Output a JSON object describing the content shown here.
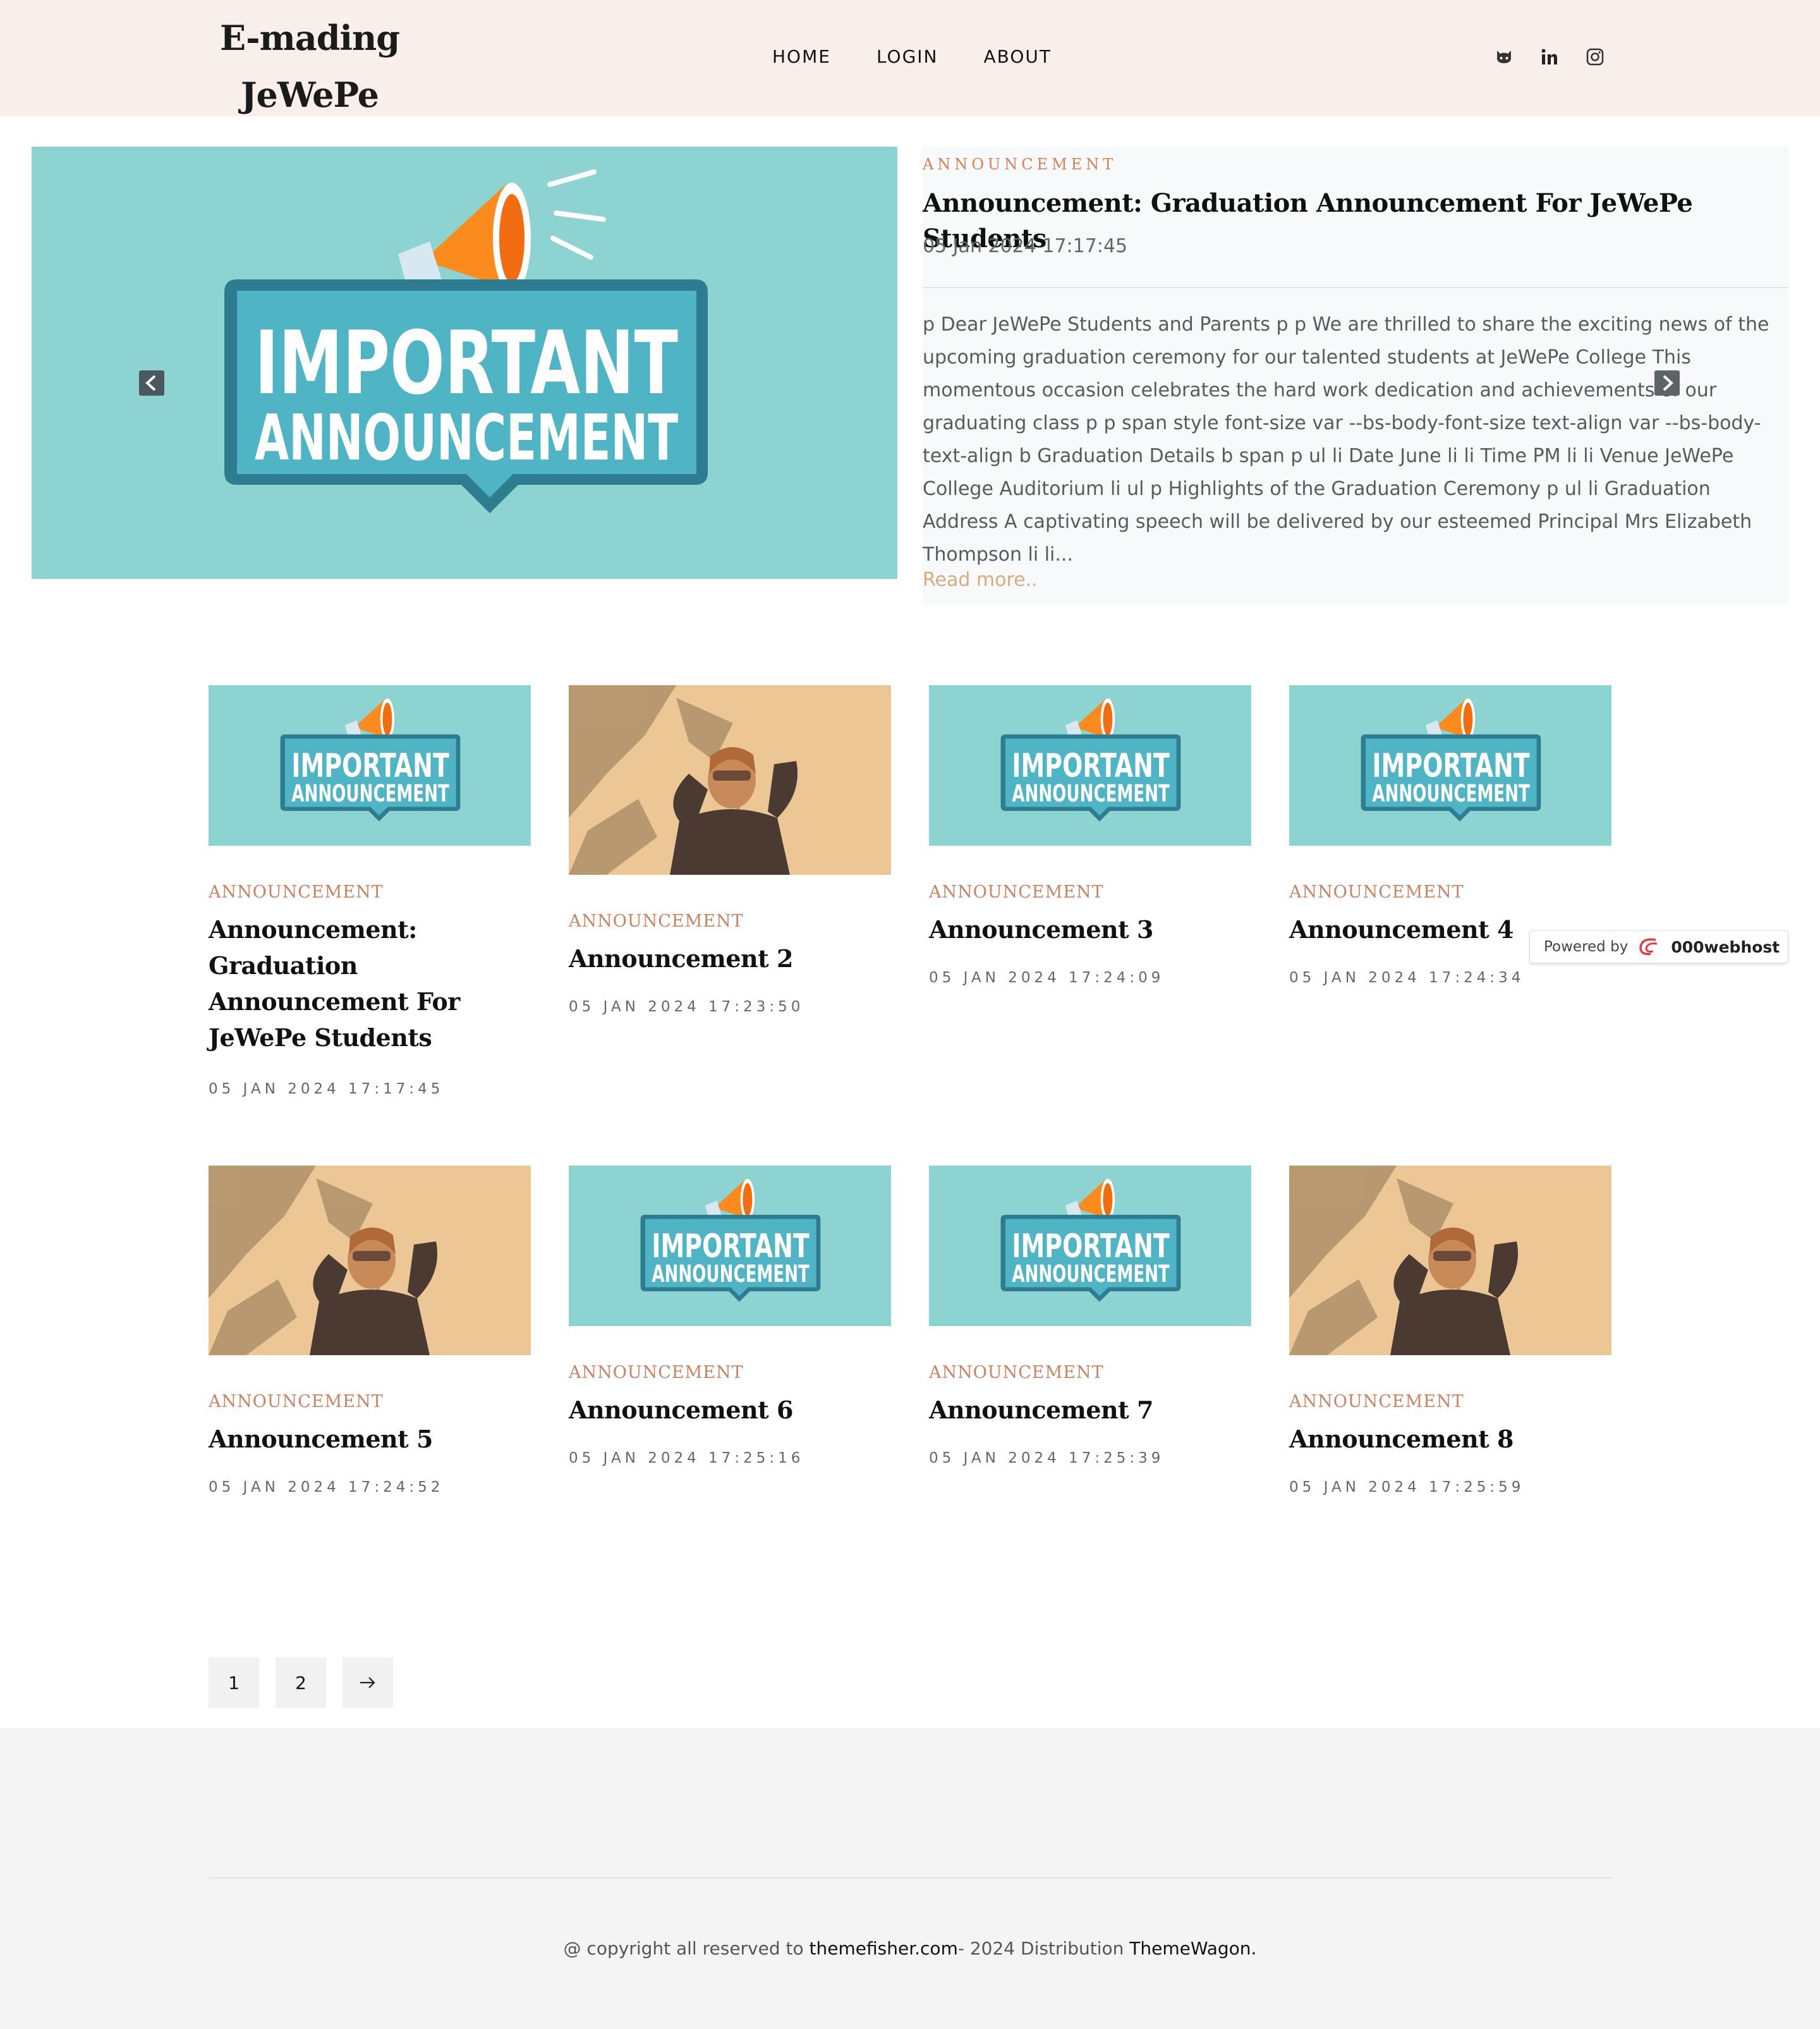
{
  "header": {
    "logo_line1": "E-mading",
    "logo_line2": "JeWePe",
    "nav": [
      {
        "label": "HOME"
      },
      {
        "label": "LOGIN"
      },
      {
        "label": "ABOUT"
      }
    ],
    "social_icons": [
      "github-icon",
      "linkedin-icon",
      "instagram-icon"
    ]
  },
  "featured": {
    "image_text_line1": "IMPORTANT",
    "image_text_line2": "ANNOUNCEMENT",
    "category": "ANNOUNCEMENT",
    "title": "Announcement: Graduation Announcement For JeWePe Students",
    "date": "05 Jan 2024 17:17:45",
    "excerpt": "p Dear JeWePe Students and Parents p p We are thrilled to share the exciting news of the upcoming graduation ceremony for our talented students at JeWePe College This momentous occasion celebrates the hard work dedication and achievements of our graduating class p p span style font-size var --bs-body-font-size text-align var --bs-body-text-align b Graduation Details b span p ul li Date June li li Time PM li li Venue JeWePe College Auditorium li ul p Highlights of the Graduation Ceremony p ul li Graduation Address A captivating speech will be delivered by our esteemed Principal Mrs Elizabeth Thompson li li...",
    "read_more": "Read more.."
  },
  "cards": [
    {
      "category": "ANNOUNCEMENT",
      "title": "Announcement: Graduation Announcement For JeWePe Students",
      "date": "05 JAN 2024 17:17:45",
      "image": "announcement"
    },
    {
      "category": "ANNOUNCEMENT",
      "title": "Announcement 2",
      "date": "05 JAN 2024 17:23:50",
      "image": "photo"
    },
    {
      "category": "ANNOUNCEMENT",
      "title": "Announcement 3",
      "date": "05 JAN 2024 17:24:09",
      "image": "announcement"
    },
    {
      "category": "ANNOUNCEMENT",
      "title": "Announcement 4",
      "date": "05 JAN 2024 17:24:34",
      "image": "announcement"
    },
    {
      "category": "ANNOUNCEMENT",
      "title": "Announcement 5",
      "date": "05 JAN 2024 17:24:52",
      "image": "photo"
    },
    {
      "category": "ANNOUNCEMENT",
      "title": "Announcement 6",
      "date": "05 JAN 2024 17:25:16",
      "image": "announcement"
    },
    {
      "category": "ANNOUNCEMENT",
      "title": "Announcement 7",
      "date": "05 JAN 2024 17:25:39",
      "image": "announcement"
    },
    {
      "category": "ANNOUNCEMENT",
      "title": "Announcement 8",
      "date": "05 JAN 2024 17:25:59",
      "image": "photo"
    }
  ],
  "powered_by": {
    "label": "Powered by",
    "brand": "000webhost"
  },
  "pagination": [
    "1",
    "2"
  ],
  "footer": {
    "prefix": "@ copyright all reserved to ",
    "link1": "themefisher.com",
    "middle": "- 2024 Distribution ",
    "link2": "ThemeWagon",
    "suffix": "."
  },
  "colors": {
    "header_bg": "#f8eeea",
    "accent": "#d2825a",
    "teal": "#8cd3d1",
    "footer_bg": "#f4f4f4"
  }
}
